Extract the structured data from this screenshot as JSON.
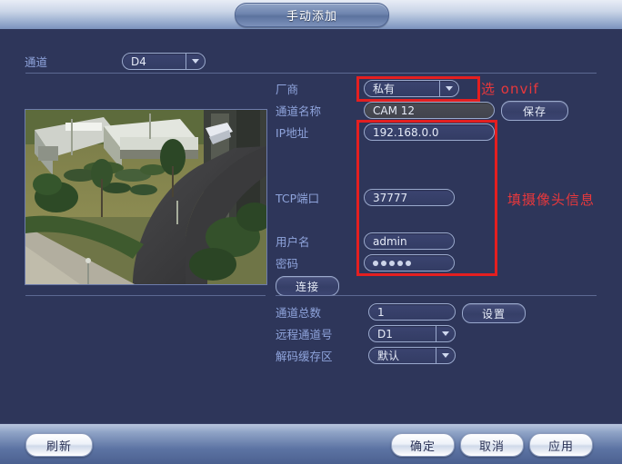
{
  "window": {
    "title": "手动添加"
  },
  "channel_row": {
    "label": "通道",
    "value": "D4"
  },
  "form": {
    "manufacturer": {
      "label": "厂商",
      "value": "私有"
    },
    "channel_name": {
      "label": "通道名称",
      "value": "CAM 12"
    },
    "ip_address": {
      "label": "IP地址",
      "value": "192.168.0.0"
    },
    "tcp_port": {
      "label": "TCP端口",
      "value": "37777"
    },
    "username": {
      "label": "用户名",
      "value": "admin"
    },
    "password": {
      "label": "密码",
      "value": "•••••",
      "dots": 5
    },
    "total_channels": {
      "label": "通道总数",
      "value": "1"
    },
    "remote_channel": {
      "label": "远程通道号",
      "value": "D1"
    },
    "decode_buffer": {
      "label": "解码缓存区",
      "value": "默认"
    }
  },
  "buttons": {
    "save": "保存",
    "connect": "连接",
    "settings": "设置",
    "refresh": "刷新",
    "ok": "确定",
    "cancel": "取消",
    "apply": "应用"
  },
  "annotations": {
    "onvif_hint": "选 onvif",
    "camera_info_hint": "填摄像头信息"
  },
  "colors": {
    "annotation_red": "#e41f20",
    "label_blue": "#8fa4dc",
    "dialog_bg": "#2e365a"
  }
}
